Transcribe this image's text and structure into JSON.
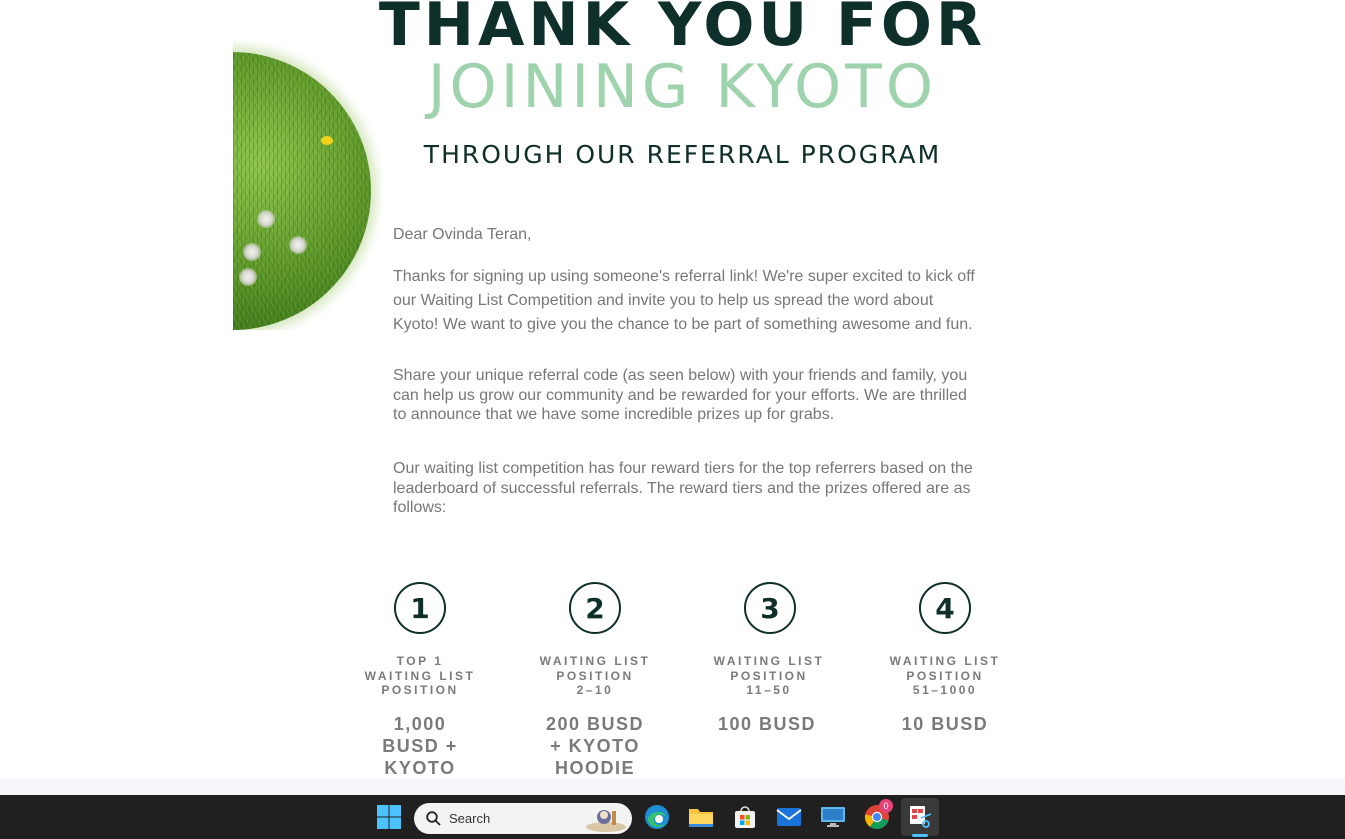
{
  "email": {
    "heading_line1": "THANK YOU FOR",
    "heading_line2": "JOINING KYOTO",
    "heading_line3": "THROUGH OUR REFERRAL PROGRAM",
    "greeting": "Dear Ovinda Teran,",
    "paragraph1": "Thanks for signing up using someone's referral link! We're super excited to kick off our Waiting List Competition and invite you to help us spread the word about Kyoto! We want to give you the chance to be part of something awesome and fun.",
    "paragraph2": "Share your unique referral code (as seen below) with your friends and family, you can help us grow our community and be rewarded for your efforts. We are thrilled to announce that we have some incredible prizes up for grabs.",
    "paragraph3": "Our waiting list competition has four reward tiers for the top referrers based on the leaderboard of successful referrals. The reward tiers and the prizes offered are as follows:",
    "tiers": [
      {
        "number": "1",
        "label_line1": "TOP 1",
        "label_line2": "WAITING LIST",
        "label_line3": "POSITION",
        "prize": "1,000 BUSD + KYOTO"
      },
      {
        "number": "2",
        "label_line1": "WAITING LIST",
        "label_line2": "POSITION",
        "label_line3": "2–10",
        "prize": "200 BUSD + KYOTO HOODIE"
      },
      {
        "number": "3",
        "label_line1": "WAITING LIST",
        "label_line2": "POSITION",
        "label_line3": "11–50",
        "prize": "100 BUSD"
      },
      {
        "number": "4",
        "label_line1": "WAITING LIST",
        "label_line2": "POSITION",
        "label_line3": "51–1000",
        "prize": "10 BUSD"
      }
    ]
  },
  "taskbar": {
    "search_label": "Search",
    "chrome_badge": "0",
    "icons": [
      "windows-start-icon",
      "search-icon",
      "edge-icon",
      "file-explorer-icon",
      "store-icon",
      "mail-icon",
      "remote-desktop-icon",
      "chrome-icon",
      "snipping-tool-icon"
    ]
  },
  "colors": {
    "heading_dark": "#0e2f2a",
    "heading_green": "#9ed3ae",
    "body_text": "#777777",
    "taskbar_bg": "#202020",
    "active_indicator": "#4cc2ff"
  }
}
